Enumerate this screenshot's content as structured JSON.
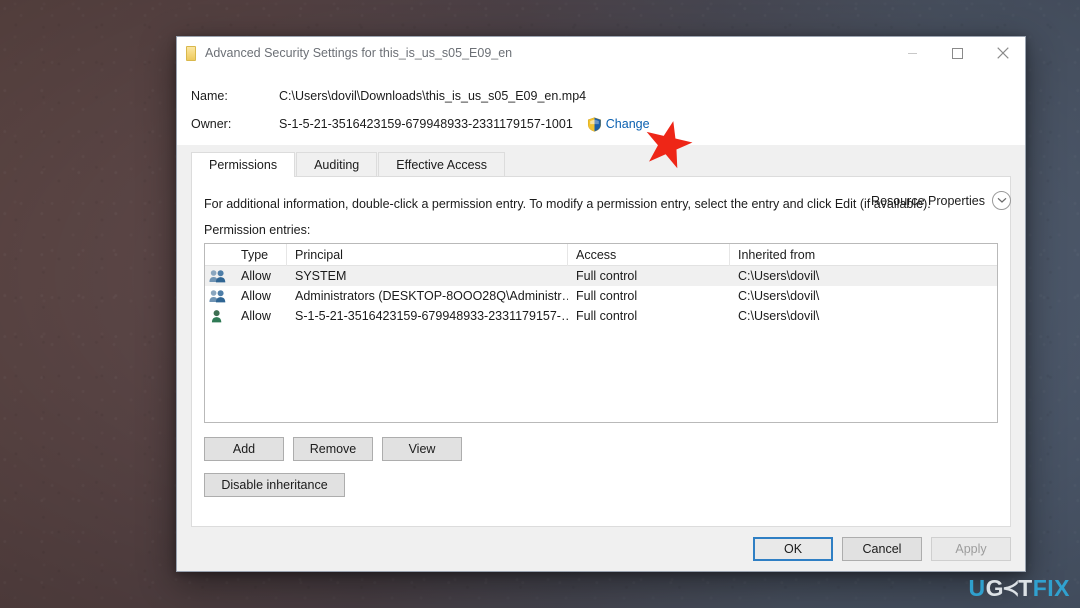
{
  "window": {
    "title": "Advanced Security Settings for this_is_us_s05_E09_en",
    "icon": "folder-icon",
    "controls": {
      "minimize": "–",
      "maximize": "□",
      "close": "✕"
    }
  },
  "header": {
    "name_label": "Name:",
    "name_value": "C:\\Users\\dovil\\Downloads\\this_is_us_s05_E09_en.mp4",
    "owner_label": "Owner:",
    "owner_value": "S-1-5-21-3516423159-679948933-2331179157-1001",
    "change_link": "Change",
    "shield_icon": "uac-shield-icon",
    "resource_properties": "Resource Properties",
    "resource_chevron_icon": "chevron-down-icon"
  },
  "tabs": [
    {
      "label": "Permissions",
      "active": true
    },
    {
      "label": "Auditing",
      "active": false
    },
    {
      "label": "Effective Access",
      "active": false
    }
  ],
  "panel": {
    "info_text": "For additional information, double-click a permission entry. To modify a permission entry, select the entry and click Edit (if available).",
    "entries_label": "Permission entries:"
  },
  "grid": {
    "columns": [
      "",
      "Type",
      "Principal",
      "Access",
      "Inherited from"
    ],
    "rows": [
      {
        "icon": "group-icon",
        "type": "Allow",
        "principal": "SYSTEM",
        "access": "Full control",
        "inherited_from": "C:\\Users\\dovil\\",
        "highlighted": true
      },
      {
        "icon": "group-icon",
        "type": "Allow",
        "principal": "Administrators (DESKTOP-8OOO28Q\\Administr…",
        "access": "Full control",
        "inherited_from": "C:\\Users\\dovil\\",
        "highlighted": false
      },
      {
        "icon": "user-icon",
        "type": "Allow",
        "principal": "S-1-5-21-3516423159-679948933-2331179157-…",
        "access": "Full control",
        "inherited_from": "C:\\Users\\dovil\\",
        "highlighted": false
      }
    ]
  },
  "actions": {
    "add": "Add",
    "remove": "Remove",
    "view": "View",
    "disable_inheritance": "Disable inheritance"
  },
  "footer": {
    "ok": "OK",
    "cancel": "Cancel",
    "apply": "Apply",
    "apply_disabled": true
  },
  "annotation": {
    "star_icon": "red-star-marker",
    "star_color": "#ee2617"
  },
  "watermark": {
    "part_u": "U",
    "part_g": "G",
    "part_mark": "≺",
    "part_t": "T",
    "part_fix": "FIX",
    "accent_color": "#2fa8d8"
  }
}
